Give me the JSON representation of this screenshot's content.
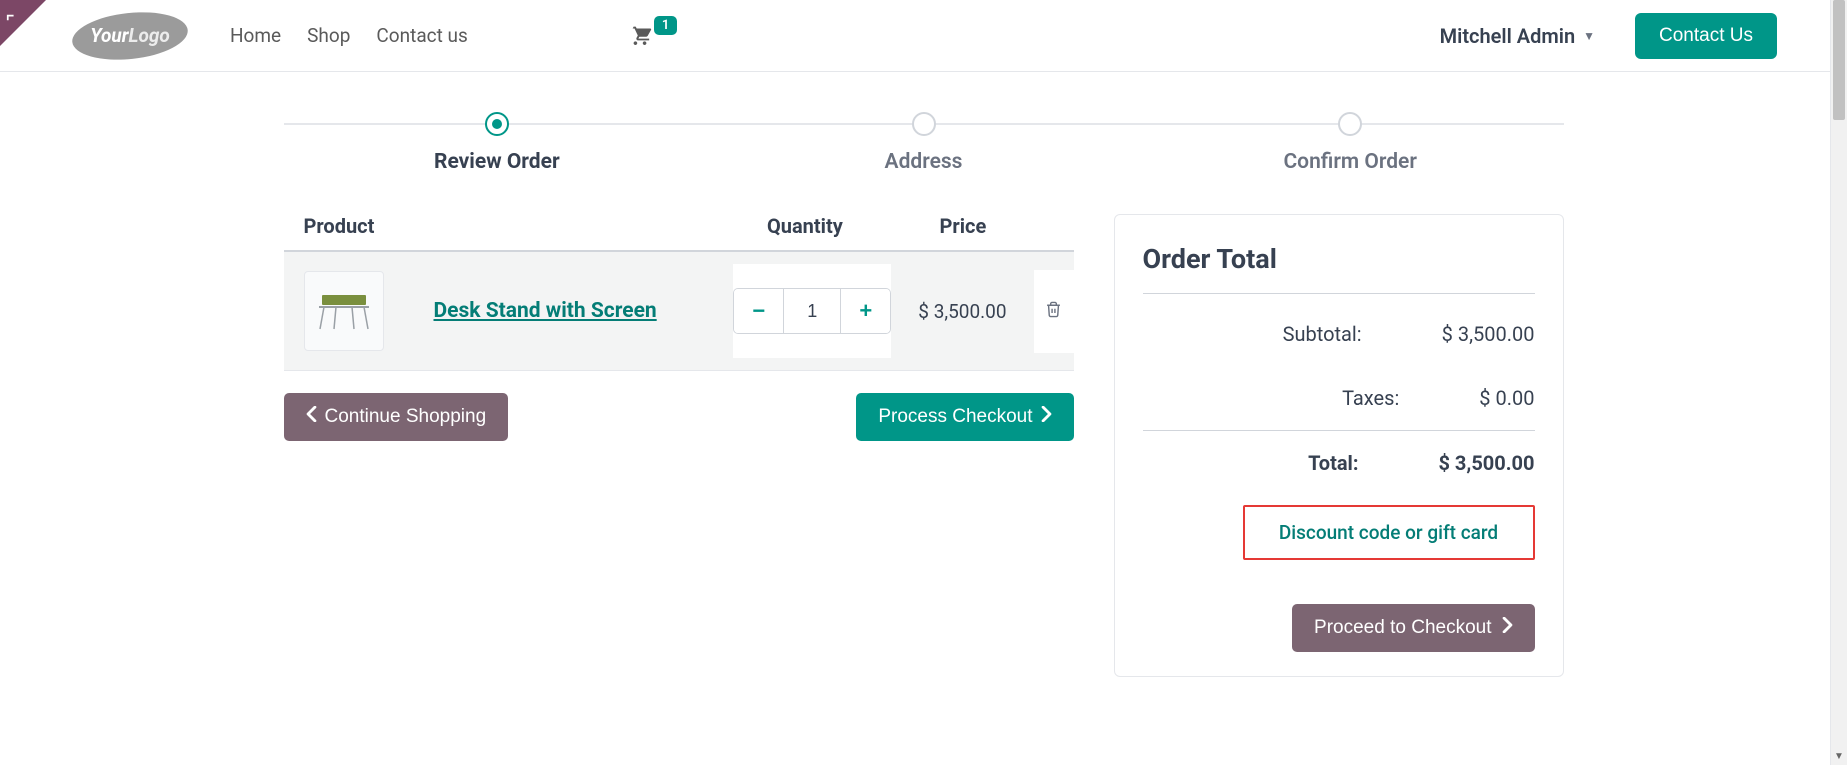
{
  "logo": {
    "part1": "Your",
    "part2": "Logo"
  },
  "nav": {
    "home": "Home",
    "shop": "Shop",
    "contact": "Contact us"
  },
  "cart": {
    "count": "1"
  },
  "user": {
    "name": "Mitchell Admin"
  },
  "contact_button": "Contact Us",
  "steps": {
    "review": "Review Order",
    "address": "Address",
    "confirm": "Confirm Order"
  },
  "table": {
    "headers": {
      "product": "Product",
      "quantity": "Quantity",
      "price": "Price"
    },
    "rows": [
      {
        "name": "Desk Stand with Screen",
        "qty": "1",
        "price": "$ 3,500.00"
      }
    ]
  },
  "actions": {
    "continue": "Continue Shopping",
    "process": "Process Checkout"
  },
  "order_total": {
    "title": "Order Total",
    "subtotal_label": "Subtotal:",
    "subtotal_value": "$ 3,500.00",
    "taxes_label": "Taxes:",
    "taxes_value": "$ 0.00",
    "total_label": "Total:",
    "total_value": "$ 3,500.00",
    "discount_link": "Discount code or gift card",
    "proceed": "Proceed to Checkout"
  }
}
